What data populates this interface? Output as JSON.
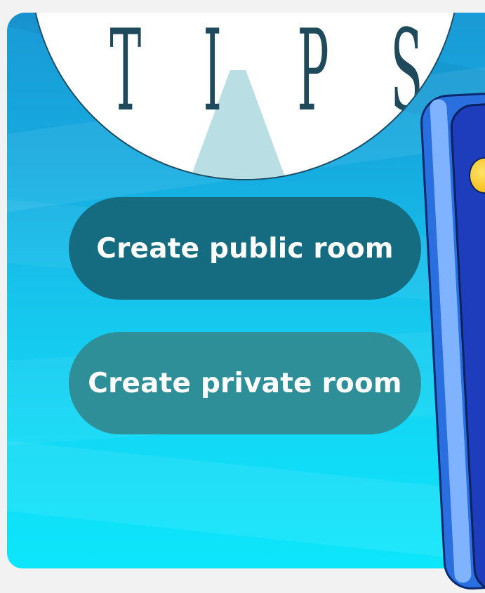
{
  "logo": {
    "letters": [
      "T",
      "I",
      "P",
      "S"
    ],
    "icon": "tips-logo-disc"
  },
  "buttons": {
    "create_public_room": "Create public room",
    "create_private_room": "Create private room"
  },
  "decor": {
    "phone_icon": "phone-illustration-icon",
    "coin_icon": "coin-icon"
  },
  "colors": {
    "background_top": "#1a9ad6",
    "background_bottom": "#0ce6fb",
    "public_button": "#156b80",
    "private_button": "#2e8f99",
    "logo_text": "#1e4a5c",
    "phone": "#2a6fe0"
  }
}
